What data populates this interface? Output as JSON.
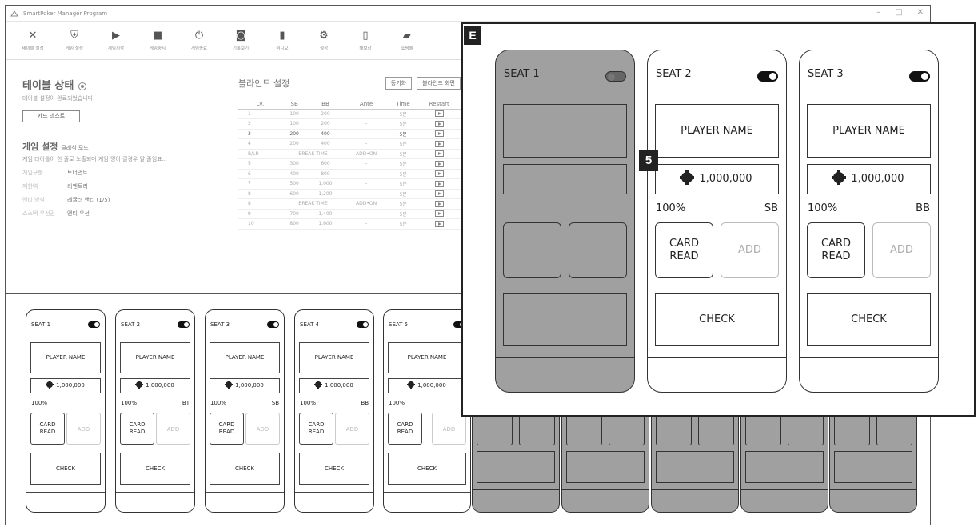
{
  "window": {
    "title": "SmartPoker Manager Program",
    "controls": [
      "–",
      "□",
      "✕"
    ]
  },
  "toolbar": [
    {
      "icon": "tools-icon",
      "glyph": "✕",
      "label": "테이블 설정"
    },
    {
      "icon": "shield-icon",
      "glyph": "⛨",
      "label": "게임 설정"
    },
    {
      "icon": "play-icon",
      "glyph": "▶",
      "label": "게임시작"
    },
    {
      "icon": "stop-icon",
      "glyph": "■",
      "label": "게임중지"
    },
    {
      "icon": "power-icon",
      "glyph": "⏻",
      "label": "게임종료"
    },
    {
      "icon": "record-icon",
      "glyph": "◙",
      "label": "기록보기"
    },
    {
      "icon": "video-icon",
      "glyph": "▮",
      "label": "비디오"
    },
    {
      "icon": "gear-icon",
      "glyph": "⚙",
      "label": "설정"
    },
    {
      "icon": "book-icon",
      "glyph": "▯",
      "label": "해보장"
    },
    {
      "icon": "bag-icon",
      "glyph": "▰",
      "label": "쇼핑몰"
    }
  ],
  "table_status": {
    "title": "테이블 상태",
    "desc": "테이블 설정이 완료되었습니다.",
    "test_button": "카드 테스트"
  },
  "game_settings": {
    "title": "게임 설정",
    "mode": "클래식 모드",
    "desc": "게임 타이틀이 한 줄로 노출되며 게임 명이 길경우 말 줄임표..",
    "rows": [
      {
        "k": "게임구분",
        "v": "토너먼트"
      },
      {
        "k": "제한여",
        "v": "리멘트리"
      },
      {
        "k": "앤티 방식",
        "v": "레귤러 앤티 (1/5)"
      },
      {
        "k": "쇼스택 우선권",
        "v": "앤티 우선"
      }
    ]
  },
  "blind": {
    "title": "블라인드 설정",
    "sync": "동기화",
    "screen": "블라인드 화면",
    "headers": [
      "Lv.",
      "SB",
      "BB",
      "Ante",
      "Time",
      "Restart"
    ],
    "rows": [
      [
        "1",
        "100",
        "200",
        "–",
        "5분"
      ],
      [
        "2",
        "100",
        "200",
        "–",
        "5분"
      ],
      [
        "3",
        "200",
        "400",
        "–",
        "5분"
      ],
      [
        "4",
        "200",
        "400",
        "–",
        "5분"
      ],
      [
        "B/LR",
        "BREAK TIME",
        "",
        "ADD•ON",
        "5분"
      ],
      [
        "5",
        "300",
        "600",
        "–",
        "5분"
      ],
      [
        "6",
        "400",
        "800",
        "–",
        "5분"
      ],
      [
        "7",
        "500",
        "1,000",
        "–",
        "5분"
      ],
      [
        "8",
        "600",
        "1,200",
        "–",
        "5분"
      ],
      [
        "8",
        "BREAK TIME",
        "",
        "ADD•ON",
        "5분"
      ],
      [
        "9",
        "700",
        "1,400",
        "–",
        "5분"
      ],
      [
        "10",
        "800",
        "1,600",
        "–",
        "5분"
      ]
    ]
  },
  "seats": [
    {
      "name": "SEAT 1",
      "player": "PLAYER NAME",
      "chips": "1,000,000",
      "pct": "100%",
      "role": "",
      "card": "CARD READ",
      "add": "ADD",
      "check": "CHECK"
    },
    {
      "name": "SEAT 2",
      "player": "PLAYER NAME",
      "chips": "1,000,000",
      "pct": "100%",
      "role": "BT",
      "card": "CARD READ",
      "add": "ADD",
      "check": "CHECK"
    },
    {
      "name": "SEAT 3",
      "player": "PLAYER NAME",
      "chips": "1,000,000",
      "pct": "100%",
      "role": "SB",
      "card": "CARD READ",
      "add": "ADD",
      "check": "CHECK"
    },
    {
      "name": "SEAT 4",
      "player": "PLAYER NAME",
      "chips": "1,000,000",
      "pct": "100%",
      "role": "BB",
      "card": "CARD READ",
      "add": "ADD",
      "check": "CHECK"
    },
    {
      "name": "SEAT 5",
      "player": "PLAYER NAME",
      "chips": "1,000,000",
      "pct": "100%",
      "role": "",
      "card": "CARD READ",
      "add": "ADD",
      "check": "CHECK"
    }
  ],
  "zoom": {
    "tag": "E",
    "marker": "5",
    "seat1": {
      "name": "SEAT 1"
    },
    "seat2": {
      "name": "SEAT 2",
      "player": "PLAYER NAME",
      "chips": "1,000,000",
      "pct": "100%",
      "role": "SB",
      "card": "CARD READ",
      "add": "ADD",
      "check": "CHECK"
    },
    "seat3": {
      "name": "SEAT 3",
      "player": "PLAYER NAME",
      "chips": "1,000,000",
      "pct": "100%",
      "role": "BB",
      "card": "CARD READ",
      "add": "ADD",
      "check": "CHECK"
    }
  },
  "colors": {
    "disabled_seat": "#a0a0a0",
    "border": "#333333"
  }
}
